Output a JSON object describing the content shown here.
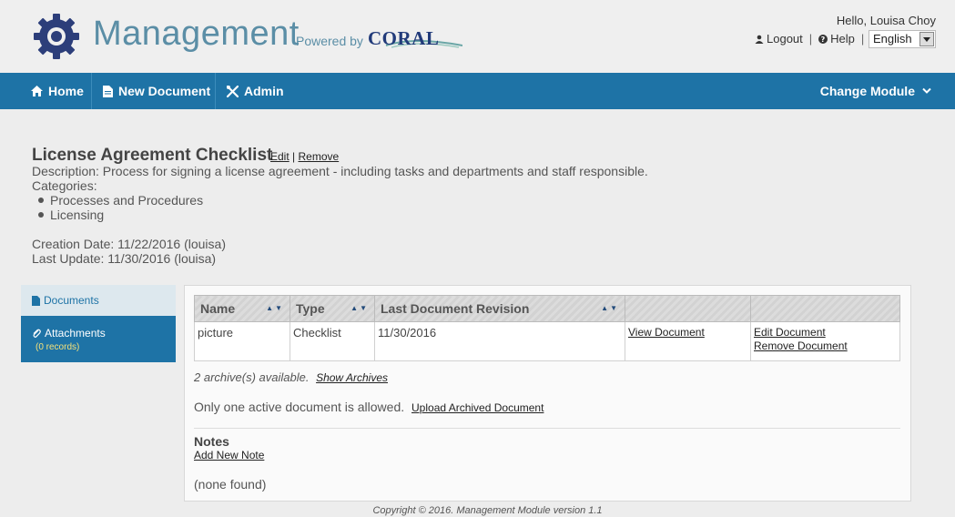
{
  "header": {
    "app_title": "Management",
    "powered_by": "Powered by",
    "brand": "CORAL",
    "greeting": "Hello, Louisa Choy",
    "logout": "Logout",
    "help": "Help",
    "separator": "|",
    "language": "English"
  },
  "nav": {
    "home": "Home",
    "new_document": "New Document",
    "admin": "Admin",
    "change_module": "Change Module"
  },
  "document": {
    "title": "License Agreement Checklist",
    "edit": "Edit",
    "sep": "|",
    "remove": "Remove",
    "description": "Description: Process for signing a license agreement - including tasks and departments and staff responsible.",
    "categories_label": "Categories:",
    "categories": [
      "Processes and Procedures",
      "Licensing"
    ],
    "creation_date": "Creation Date: 11/22/2016 (louisa)",
    "last_update": "Last Update: 11/30/2016 (louisa)"
  },
  "sidebar": {
    "documents": "Documents",
    "attachments": "Attachments",
    "attachments_count": "(0 records)"
  },
  "table": {
    "headers": [
      "Name",
      "Type",
      "Last Document Revision",
      "",
      ""
    ],
    "sort_glyph": "▲▼",
    "rows": [
      {
        "name": "picture",
        "type": "Checklist",
        "revision": "11/30/2016",
        "view": "View Document",
        "edit": "Edit Document",
        "remove": "Remove Document"
      }
    ]
  },
  "archives": {
    "text": "2 archive(s) available.",
    "link": "Show Archives"
  },
  "upload": {
    "text": "Only one active document is allowed.",
    "link": "Upload Archived Document"
  },
  "notes": {
    "title": "Notes",
    "add": "Add New Note",
    "empty": "(none found)"
  },
  "footer": {
    "text": "Copyright © 2016. Management Module version 1.1"
  },
  "colors": {
    "nav_blue": "#1e73a6",
    "title_blue": "#5b8ea6",
    "gear_navy": "#2c3e7a"
  }
}
